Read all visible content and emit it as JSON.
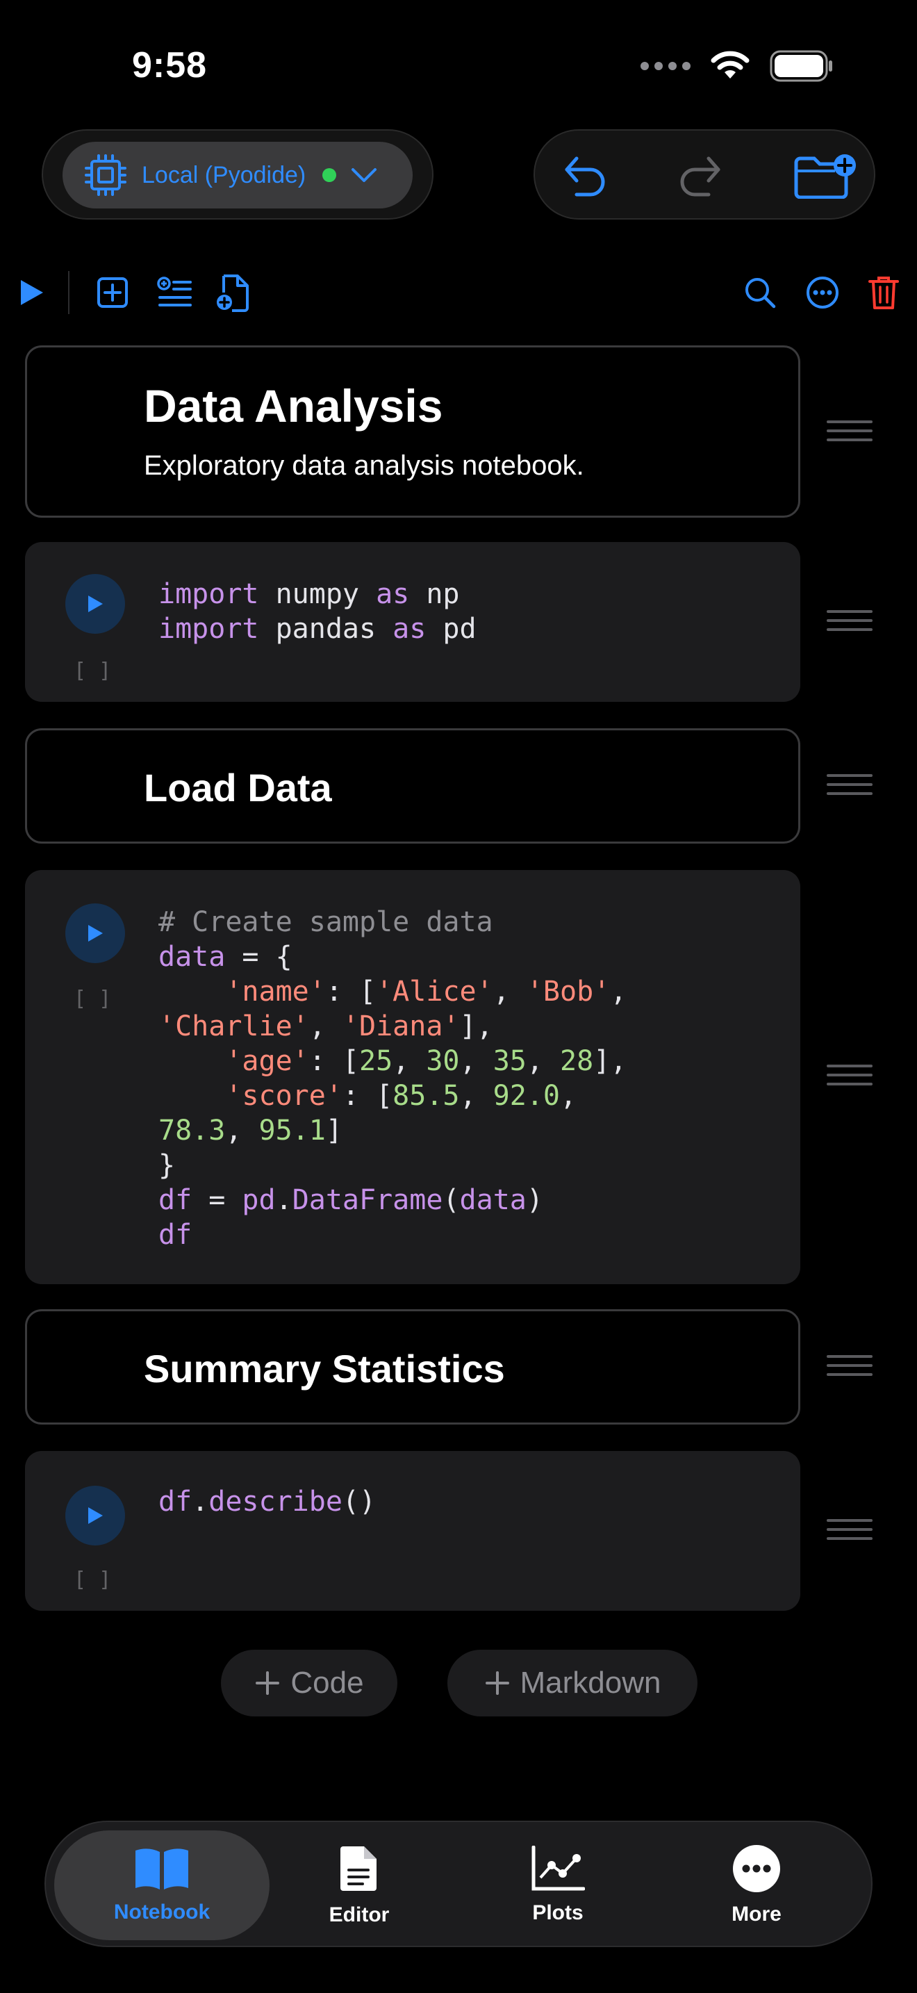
{
  "status": {
    "time": "9:58"
  },
  "kernel": {
    "label": "Local (Pyodide)",
    "status_color": "#30d158"
  },
  "colors": {
    "accent": "#2f8cff",
    "danger": "#ff3b30"
  },
  "cells": {
    "md1": {
      "title": "Data Analysis",
      "body": "Exploratory data analysis notebook."
    },
    "code1": {
      "exec": "[ ]"
    },
    "md2": {
      "title": "Load Data"
    },
    "code2": {
      "exec": "[ ]"
    },
    "md3": {
      "title": "Summary Statistics"
    },
    "code3": {
      "exec": "[ ]"
    }
  },
  "code_tokens": {
    "c1": [
      "import",
      " numpy ",
      "as",
      " np",
      "import",
      " pandas ",
      "as",
      " pd"
    ],
    "c2": [
      "# Create sample data",
      "data",
      " = {",
      "'name'",
      ": [",
      "'Alice'",
      ", ",
      "'Bob'",
      ",",
      "'Charlie'",
      ", ",
      "'Diana'",
      "],",
      "'age'",
      ": [",
      "25",
      ", ",
      "30",
      ", ",
      "35",
      ", ",
      "28",
      "],",
      "'score'",
      ": [",
      "85.5",
      ", ",
      "92.0",
      ",",
      "78.3",
      ", ",
      "95.1",
      "]",
      "}",
      "df",
      " = ",
      "pd",
      ".",
      "DataFrame",
      "(",
      "data",
      ")",
      "df"
    ],
    "c3": [
      "df",
      ".",
      "describe",
      "()"
    ]
  },
  "add_buttons": {
    "code": "Code",
    "markdown": "Markdown"
  },
  "tabs": [
    {
      "label": "Notebook",
      "icon": "book-icon",
      "active": true
    },
    {
      "label": "Editor",
      "icon": "document-icon",
      "active": false
    },
    {
      "label": "Plots",
      "icon": "chart-icon",
      "active": false
    },
    {
      "label": "More",
      "icon": "more-icon",
      "active": false
    }
  ]
}
